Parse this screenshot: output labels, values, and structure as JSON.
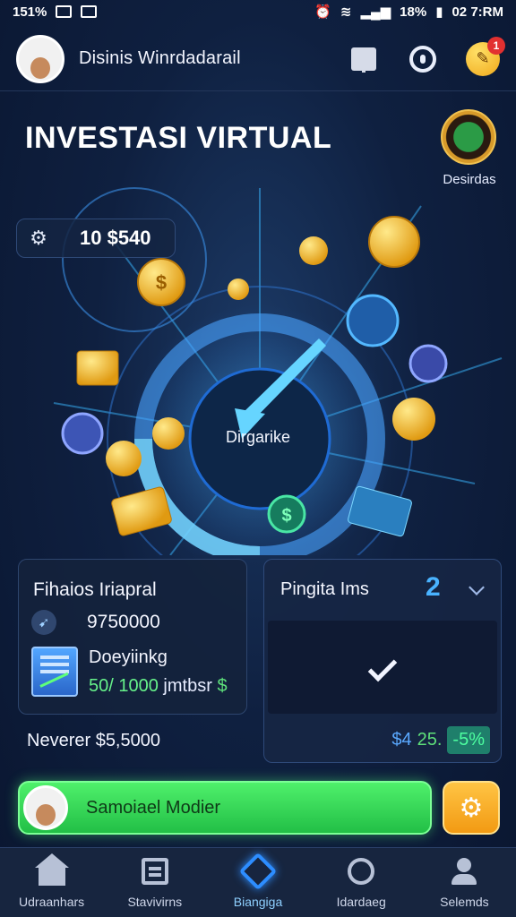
{
  "status_bar": {
    "left_text": "151%",
    "right_battery": "18%",
    "right_time": "02 7:RM"
  },
  "header": {
    "name": "Disinis Winrdadarail",
    "notification_count": "1"
  },
  "hero": {
    "title": "INVESTASI VIRTUAL",
    "badge_label": "Desirdas",
    "balance_value": "10 $540",
    "dial_label": "Dirgarike"
  },
  "card_left": {
    "title": "Fihaios Iriapral",
    "amount": "9750000",
    "label_2": "Doeyiinkg",
    "progress_value": "50/ 1000",
    "progress_unit": "jmtbsr",
    "progress_symbol": "$"
  },
  "card_right": {
    "title": "Pingita Ims",
    "number": "2",
    "stat_a": "$4",
    "stat_b": "25.",
    "stat_c": "-5%"
  },
  "investment_text": "Neverer $5,5000",
  "cta": {
    "label": "Samoiael Modier"
  },
  "bottom_nav": [
    {
      "label": "Udraanhars",
      "icon": "home-icon"
    },
    {
      "label": "Stavivirns",
      "icon": "box-icon"
    },
    {
      "label": "Biangiga",
      "icon": "arrow-icon"
    },
    {
      "label": "Idardaeg",
      "icon": "timer-icon"
    },
    {
      "label": "Selemds",
      "icon": "user-icon"
    }
  ],
  "colors": {
    "accent_green": "#4ff06b",
    "accent_blue": "#49b3ff",
    "accent_gold": "#f2a81a",
    "background": "#0f2040"
  }
}
